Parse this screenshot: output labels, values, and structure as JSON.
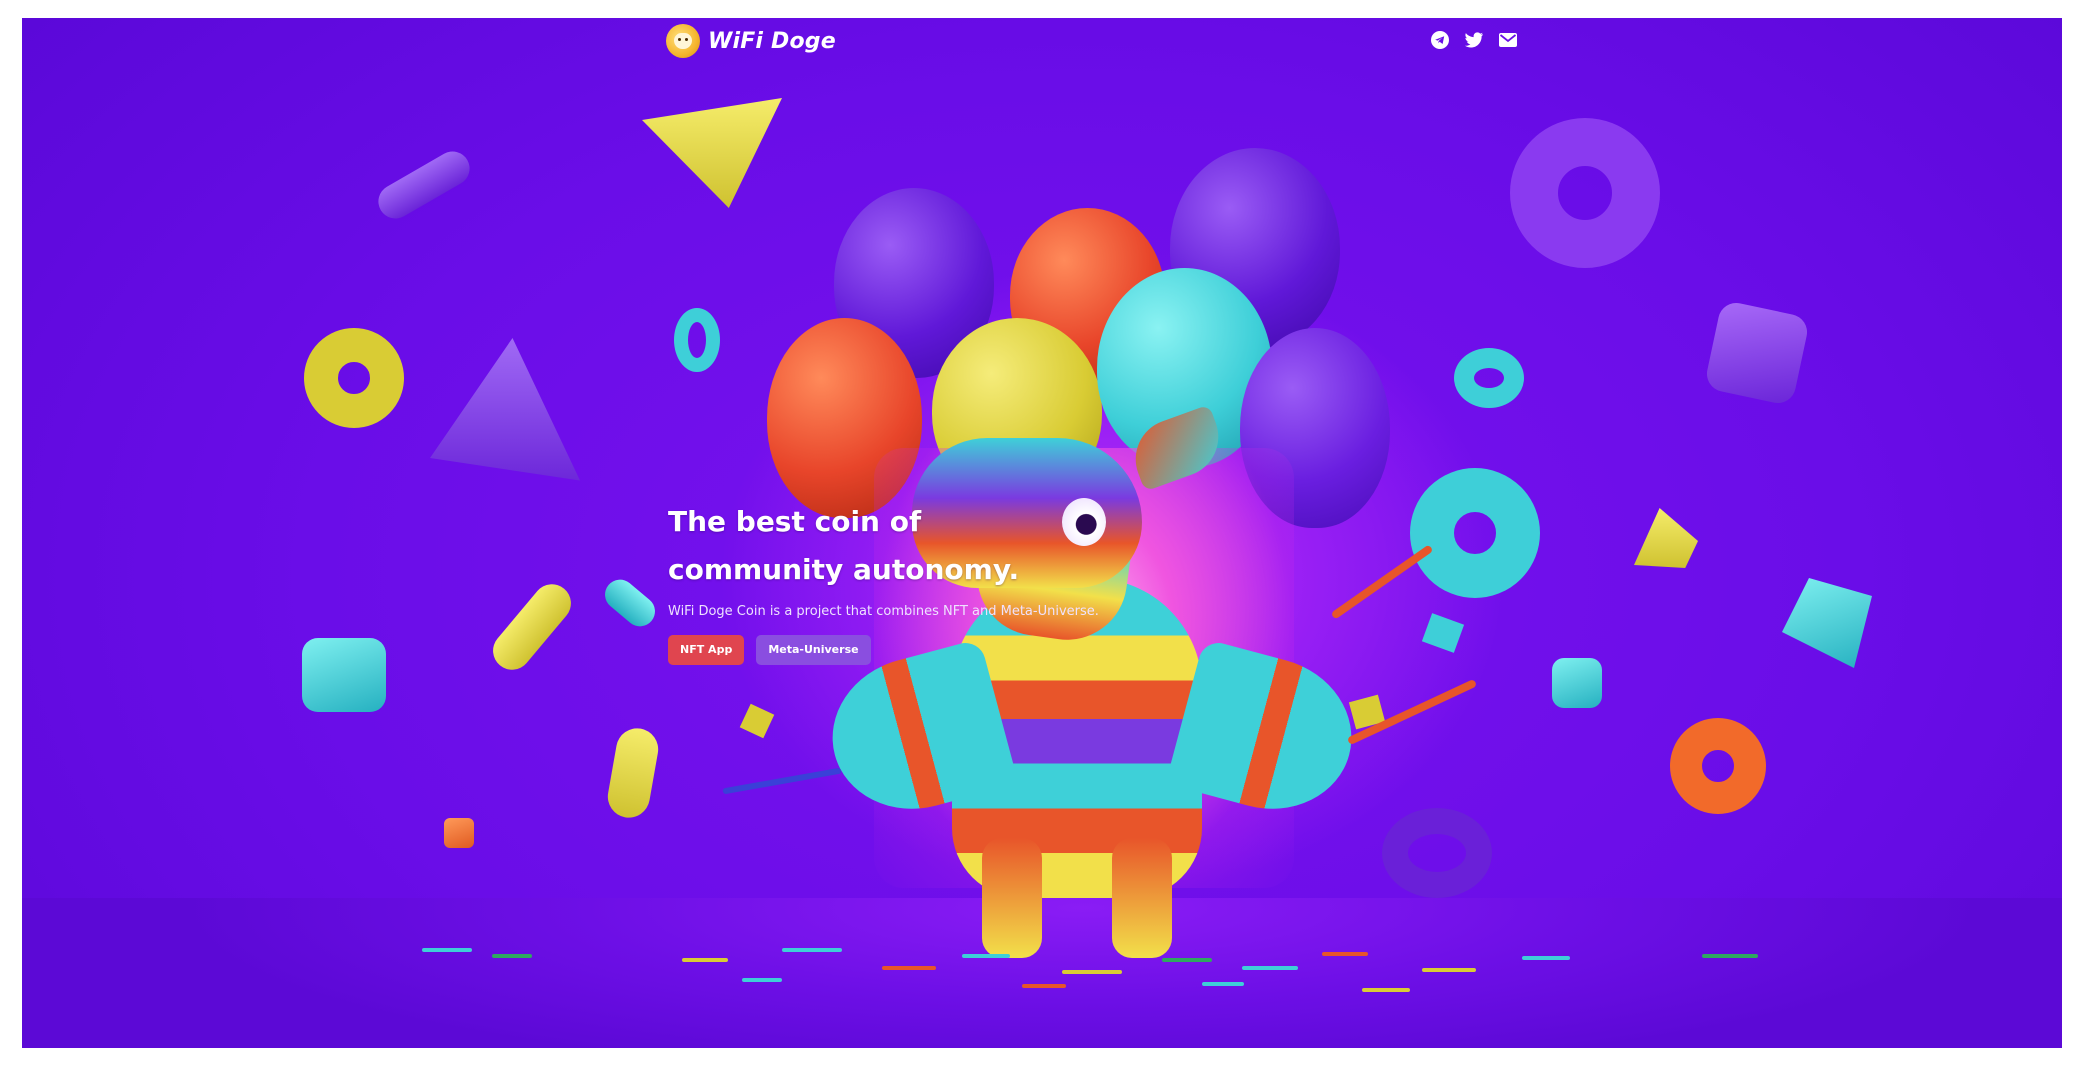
{
  "header": {
    "logo_text": "WiFi Doge",
    "social_icons": [
      "telegram-icon",
      "twitter-icon",
      "email-icon"
    ]
  },
  "hero": {
    "title_line1": "The best coin of",
    "title_line2": "community autonomy.",
    "subtitle": "WiFi Doge Coin is a project that combines NFT and Meta-Universe.",
    "buttons": {
      "nft_app": "NFT App",
      "meta_universe": "Meta-Universe"
    }
  },
  "colors": {
    "background": "#6a0de8",
    "nft_button": "#e0454f",
    "meta_button": "#8a4ee0",
    "logo": "#f5b52e"
  }
}
